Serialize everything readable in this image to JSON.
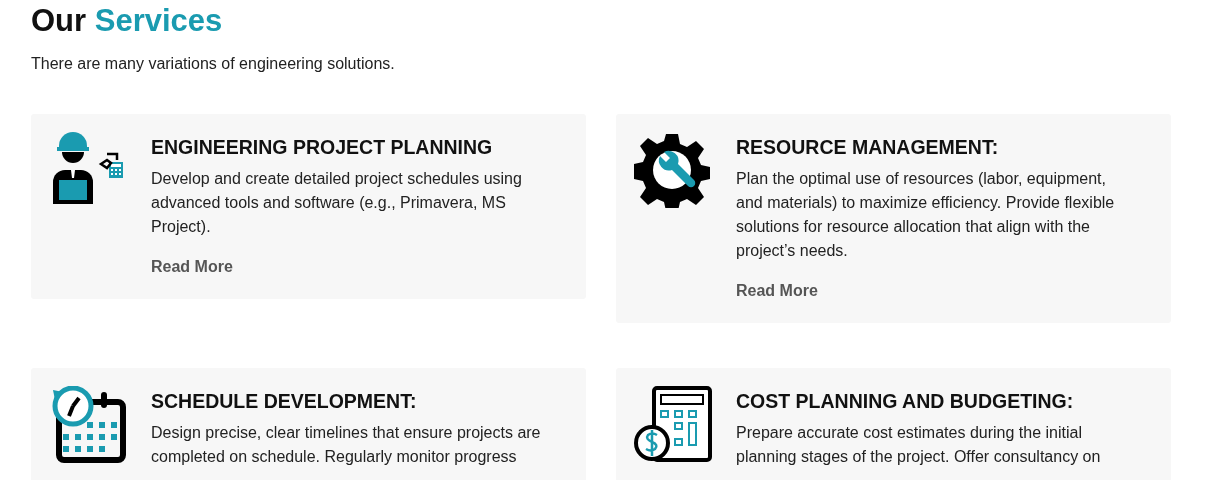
{
  "heading": {
    "prefix": "Our",
    "highlight": "Services"
  },
  "subtitle": "There are many variations of engineering solutions.",
  "services": [
    {
      "title": "ENGINEERING PROJECT PLANNING",
      "description": "Develop and create detailed project schedules using advanced tools and software (e.g., Primavera, MS Project).",
      "link": "Read More"
    },
    {
      "title": "RESOURCE MANAGEMENT:",
      "description": "Plan the optimal use of resources (labor, equipment, and materials) to maximize efficiency. Provide flexible solutions for resource allocation that align with the project’s needs.",
      "link": "Read More"
    },
    {
      "title": "SCHEDULE DEVELOPMENT:",
      "description": "Design precise, clear timelines that ensure projects are completed on schedule. Regularly monitor progress"
    },
    {
      "title": "COST PLANNING AND BUDGETING:",
      "description": "Prepare accurate cost estimates during the initial planning stages of the project. Offer consultancy on"
    }
  ]
}
